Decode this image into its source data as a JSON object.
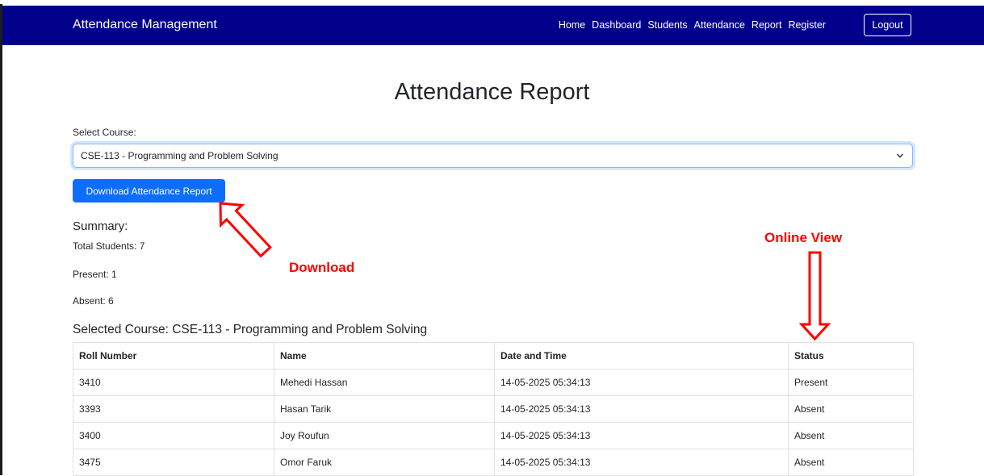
{
  "navbar": {
    "brand": "Attendance Management",
    "links": [
      "Home",
      "Dashboard",
      "Students",
      "Attendance",
      "Report",
      "Register"
    ],
    "logout": "Logout"
  },
  "page": {
    "title": "Attendance Report",
    "select_label": "Select Course:",
    "selected_course": "CSE-113 - Programming and Problem Solving",
    "download_button": "Download Attendance Report"
  },
  "summary": {
    "title": "Summary:",
    "total": "Total Students: 7",
    "present": "Present: 1",
    "absent": "Absent: 6"
  },
  "annotations": {
    "download": "Download",
    "online_view": "Online View"
  },
  "table": {
    "caption": "Selected Course: CSE-113 - Programming and Problem Solving",
    "headers": [
      "Roll Number",
      "Name",
      "Date and Time",
      "Status"
    ],
    "rows": [
      [
        "3410",
        "Mehedi Hassan",
        "14-05-2025 05:34:13",
        "Present"
      ],
      [
        "3393",
        "Hasan Tarik",
        "14-05-2025 05:34:13",
        "Absent"
      ],
      [
        "3400",
        "Joy Roufun",
        "14-05-2025 05:34:13",
        "Absent"
      ],
      [
        "3475",
        "Omor Faruk",
        "14-05-2025 05:34:13",
        "Absent"
      ]
    ]
  },
  "colors": {
    "navbar": "#00008b",
    "primary": "#0d6efd",
    "annotation": "#ff0000"
  }
}
